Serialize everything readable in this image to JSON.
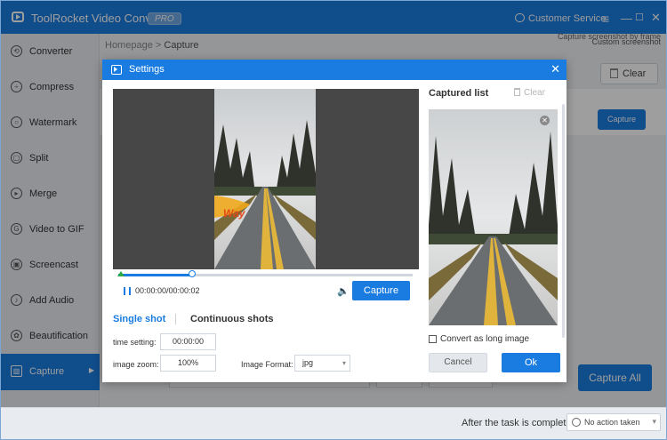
{
  "app": {
    "title": "ToolRocket Video Converter",
    "badge": "PRO",
    "customer_service": "Customer Service",
    "accent_color": "#1a7ce0"
  },
  "window_controls": {
    "menu_icon": "menu-icon",
    "minimize_icon": "minimize-icon",
    "maximize_icon": "maximize-icon",
    "close_icon": "close-icon",
    "menu_glyph": "≡",
    "minimize_glyph": "—",
    "maximize_glyph": "☐",
    "close_glyph": "✕"
  },
  "sidebar": {
    "items": [
      {
        "label": "Converter",
        "icon": "converter-icon",
        "glyph": "⟲"
      },
      {
        "label": "Compress",
        "icon": "compress-icon",
        "glyph": "÷"
      },
      {
        "label": "Watermark",
        "icon": "watermark-icon",
        "glyph": "○"
      },
      {
        "label": "Split",
        "icon": "split-icon",
        "glyph": "▢"
      },
      {
        "label": "Merge",
        "icon": "merge-icon",
        "glyph": "▸"
      },
      {
        "label": "Video to GIF",
        "icon": "gif-icon",
        "glyph": "G"
      },
      {
        "label": "Screencast",
        "icon": "screencast-icon",
        "glyph": "▣"
      },
      {
        "label": "Add Audio",
        "icon": "audio-icon",
        "glyph": "♪"
      },
      {
        "label": "Beautification",
        "icon": "beautification-icon",
        "glyph": "✿"
      },
      {
        "label": "Capture",
        "icon": "capture-icon",
        "glyph": "▧",
        "active": true
      }
    ]
  },
  "breadcrumb": {
    "home": "Homepage",
    "separator": ">",
    "current": "Capture"
  },
  "background": {
    "hint_line1": "Capture screenshot by frame",
    "hint_line2": "Custom screenshot",
    "clear_label": "Clear",
    "capture_label": "Capture",
    "capture_all_label": "Capture All"
  },
  "status_bar": {
    "after_task_label": "After the task is completed",
    "after_task_value": "No action taken"
  },
  "dialog": {
    "title": "Settings",
    "close_glyph": "✕",
    "playback": {
      "time_readout": "00:00:00/00:00:02",
      "progress_fraction": 0.25,
      "capture_label": "Capture",
      "sticker_text": "Way",
      "volume_glyph": "🔈"
    },
    "tabs": {
      "single": "Single shot",
      "continuous": "Continuous shots"
    },
    "fields": {
      "time_setting_label": "time setting:",
      "time_setting_value": "00:00:00",
      "image_zoom_label": "image zoom:",
      "image_zoom_value": "100%",
      "image_format_label": "Image Format:",
      "image_format_value": "jpg"
    },
    "captured_list": {
      "title": "Captured list",
      "clear_label": "Clear",
      "remove_glyph": "✕",
      "convert_long_label": "Convert as long image",
      "convert_long_checked": false
    },
    "cancel_label": "Cancel",
    "ok_label": "Ok"
  }
}
